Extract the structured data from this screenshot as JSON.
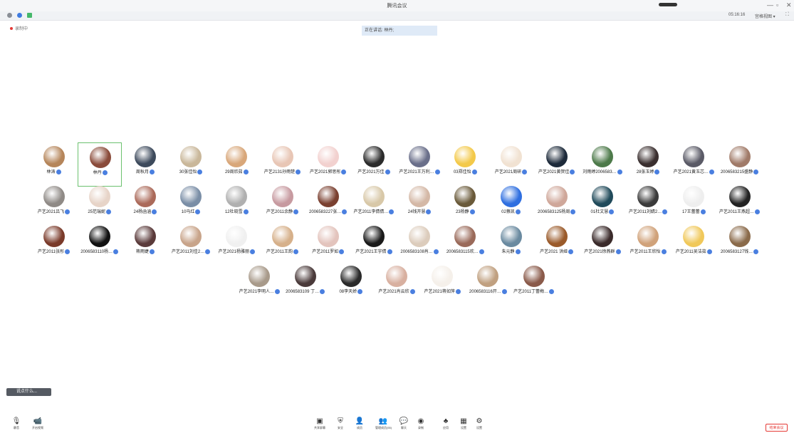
{
  "window": {
    "title": "腾讯会议",
    "controls": [
      "—",
      "▫",
      "✕"
    ]
  },
  "toolbar_top": {
    "timer": "05:16:16",
    "view_label": "宫格视图 ▾",
    "fullscreen_icon": "fullscreen-icon"
  },
  "recording_label": "录制中",
  "speaking_label": "正在讲话: 林丹;",
  "participants": [
    "林涛",
    "林丹",
    "周秋月",
    "30张佳怡",
    "29周欣茹",
    "产艺2131孙雨楚",
    "产艺2021郭思彤",
    "产艺2021万佳",
    "产艺2021王万利…",
    "03郑佳怡",
    "产艺2021周研",
    "产艺2021黄贺佳",
    "刘雨婷2006583…",
    "28张玉婷",
    "产艺2021黄玉芯…",
    "2006583215盛静",
    "产艺2021吕飞",
    "25范瑞妮",
    "24杨函涵",
    "10马红",
    "12杜晓雪",
    "产艺2011余静",
    "2006583227张…",
    "产艺2011李倩倩…",
    "24钱开慧",
    "23杨静",
    "02蔡凯",
    "2006583125杨周",
    "01杜文慧",
    "产艺2011刘婧2…",
    "17王蕾蕾",
    "产艺2011王燕超…",
    "产艺2011张彤",
    "2006583110杨…",
    "蒋雨婕",
    "产艺2011刘佳2…",
    "产艺2021杨雅丽",
    "产艺2011王韵",
    "产艺2011罗如",
    "产艺2021王宇倩",
    "2006583108肖…",
    "2006583115欢…",
    "朱元静",
    "产艺2021 洪娅",
    "产艺2021徐燕群",
    "产艺2011王欣怡",
    "产艺2011吴洁茹",
    "2006583127钱…",
    "产艺2021李明人…",
    "2006583109 丁…",
    "08李天娇",
    "产艺2021肖云欣",
    "产艺2021蒋如萍",
    "2006583116开…",
    "产艺2011丁蕾梅…"
  ],
  "active_participant_index": 1,
  "chat_input_label": "说点什么...",
  "bottom_toolbar": {
    "left": [
      {
        "icon": "microphone-icon",
        "label": "静音"
      },
      {
        "icon": "camera-icon",
        "label": "开启视频"
      }
    ],
    "center": [
      {
        "icon": "screen-share-icon",
        "label": "共享屏幕"
      },
      {
        "icon": "security-icon",
        "label": "安全"
      },
      {
        "icon": "members-icon",
        "label": "成员"
      },
      {
        "icon": "manage-members-icon",
        "label": "管理成员(55)"
      },
      {
        "icon": "chat-icon",
        "label": "聊天"
      },
      {
        "icon": "record-icon",
        "label": "录制"
      },
      {
        "icon": "apps-icon",
        "label": "应用"
      },
      {
        "icon": "grid-icon",
        "label": "设置"
      },
      {
        "icon": "settings-icon",
        "label": "设置"
      }
    ],
    "end_label": "结束会议"
  },
  "colors": {
    "accent": "#4a7fe0",
    "active_border": "#6cc16f",
    "end": "#e53935"
  }
}
